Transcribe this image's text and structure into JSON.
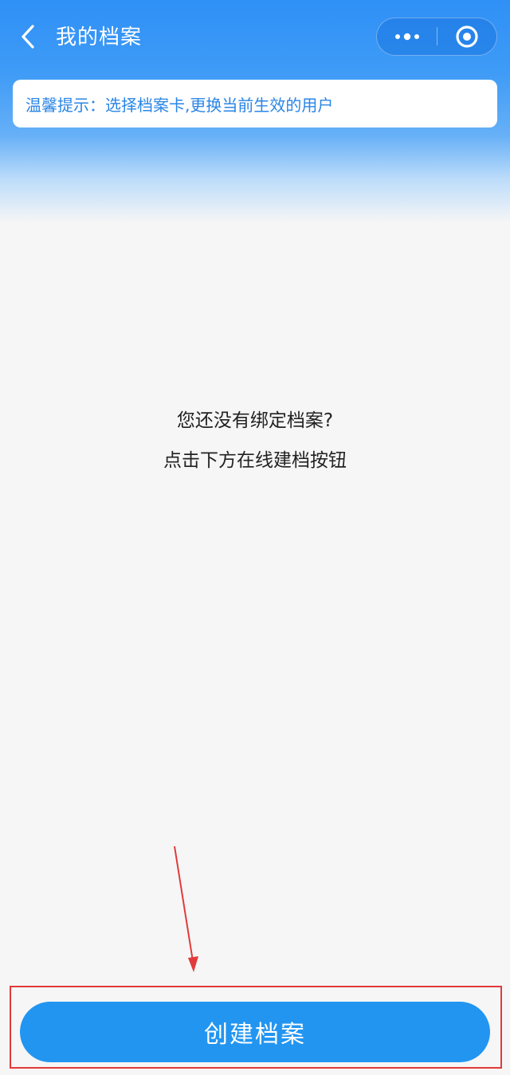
{
  "nav": {
    "title": "我的档案",
    "back_icon": "chevron-left-icon",
    "more_icon": "more-dots-icon",
    "close_icon": "target-circle-icon"
  },
  "tip": {
    "text": "温馨提示：选择档案卡,更换当前生效的用户"
  },
  "empty_state": {
    "line1": "您还没有绑定档案?",
    "line2": "点击下方在线建档按钮"
  },
  "actions": {
    "create_label": "创建档案"
  },
  "colors": {
    "header_blue": "#2f90f6",
    "tip_text": "#2a85e6",
    "button_blue": "#2295f1",
    "annotation_red": "#e23a3a",
    "background": "#f6f6f6"
  }
}
